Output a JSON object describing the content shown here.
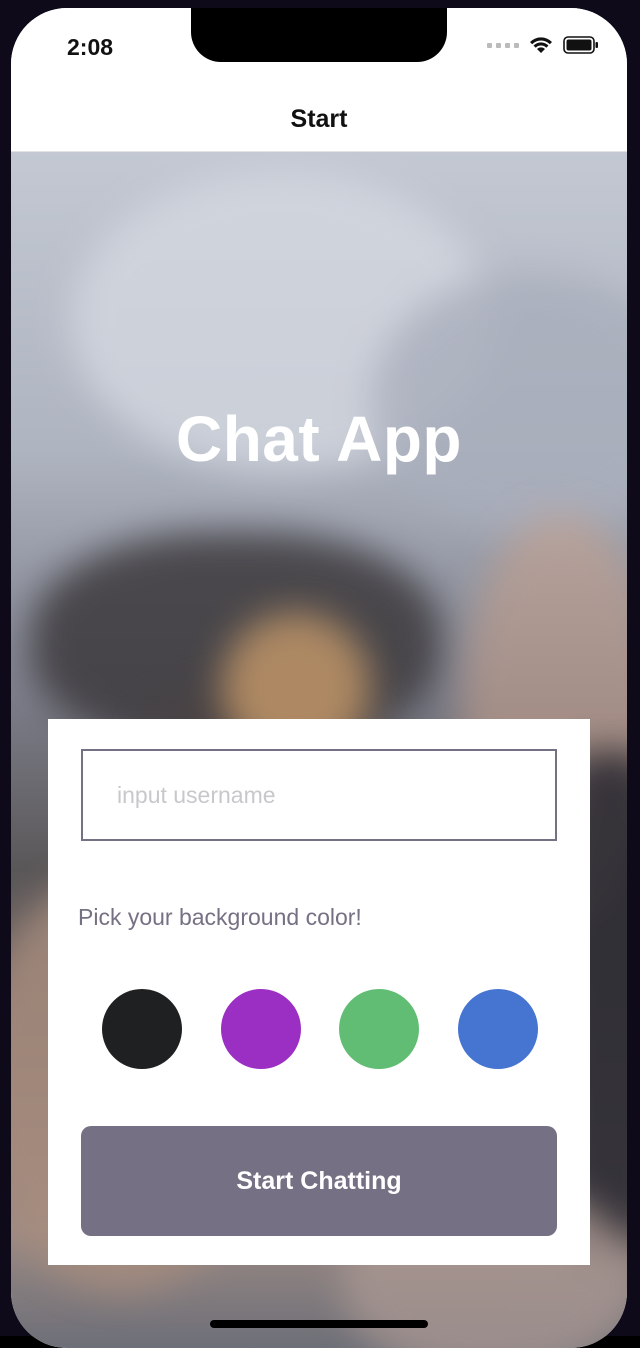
{
  "status_bar": {
    "time": "2:08"
  },
  "nav": {
    "title": "Start"
  },
  "hero": {
    "title": "Chat App"
  },
  "form": {
    "username_placeholder": "input username",
    "username_value": "",
    "color_prompt": "Pick your background color!",
    "colors": [
      "#1f2021",
      "#9b2fc3",
      "#62bd74",
      "#4574d1"
    ],
    "start_button_label": "Start Chatting"
  },
  "theme": {
    "accent": "#757083",
    "card_background": "#ffffff"
  }
}
